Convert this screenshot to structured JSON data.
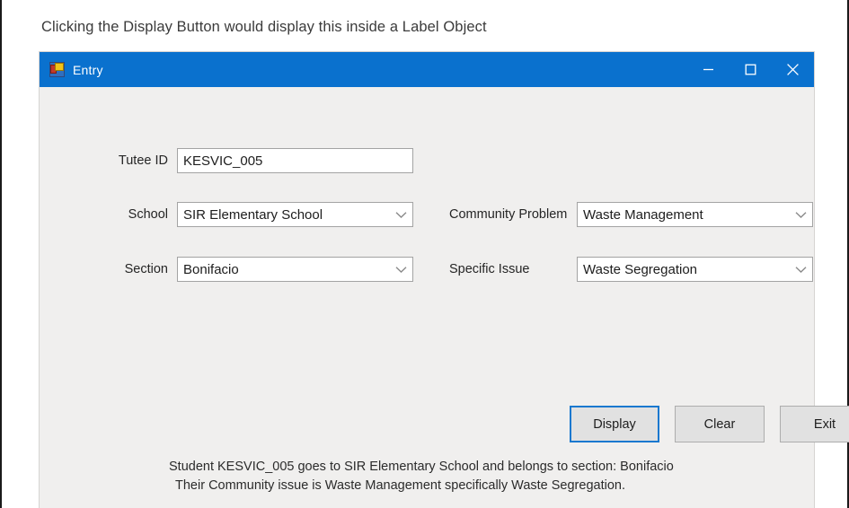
{
  "caption": "Clicking the Display Button would display this inside a Label Object",
  "window": {
    "title": "Entry",
    "icon": "vb-form-icon",
    "controls": {
      "minimize": "minimize-icon",
      "maximize": "maximize-icon",
      "close": "close-icon"
    },
    "accent_color": "#0a71ce",
    "client_color": "#f0efee"
  },
  "form": {
    "tutee_id": {
      "label": "Tutee ID",
      "value": "KESVIC_005",
      "placeholder": ""
    },
    "school": {
      "label": "School",
      "value": "SIR Elementary School",
      "arrow_icon": "chevron-down-icon"
    },
    "section": {
      "label": "Section",
      "value": "Bonifacio",
      "arrow_icon": "chevron-down-icon"
    },
    "community_problem": {
      "label": "Community Problem",
      "value": "Waste Management",
      "arrow_icon": "chevron-down-icon"
    },
    "specific_issue": {
      "label": "Specific Issue",
      "value": "Waste Segregation",
      "arrow_icon": "chevron-down-icon"
    }
  },
  "buttons": {
    "display": "Display",
    "clear": "Clear",
    "exit": "Exit",
    "focused": "display",
    "focus_color": "#1878cf"
  },
  "output": {
    "line1": "Student KESVIC_005 goes to SIR Elementary School and belongs to section: Bonifacio",
    "line2": "Their Community issue is Waste Management specifically Waste Segregation."
  }
}
